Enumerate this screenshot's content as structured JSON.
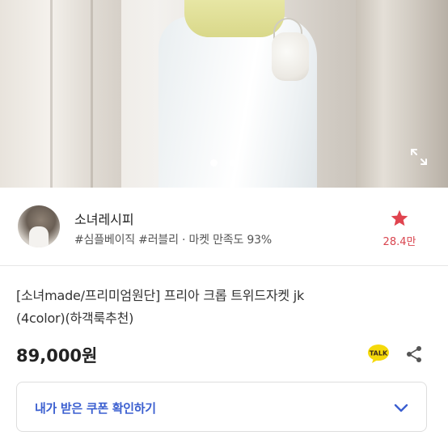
{
  "carousel": {
    "slide_count": 2,
    "active_index": 0
  },
  "seller": {
    "name": "소녀레시피",
    "tags": "#심플베이직 #러블리 · 마켓 만족도 93%",
    "favorite_count": "28.4만"
  },
  "product": {
    "title_line1": "[소녀made/프리미엄원단] 프리아 크롭 트위드자켓 jk",
    "title_line2": "(4color)(하객룩추천)",
    "price": "89,000원"
  },
  "coupon": {
    "label": "내가 받은 쿠폰 확인하기"
  },
  "icons": {
    "expand": "expand-icon",
    "favorite": "star-icon",
    "talk": "kakao-talk-icon",
    "share": "share-icon",
    "chevron": "chevron-down-icon"
  },
  "colors": {
    "accent_red": "#e0444f",
    "coupon_blue": "#3b5fd0",
    "talk_yellow": "#f5d90a"
  }
}
